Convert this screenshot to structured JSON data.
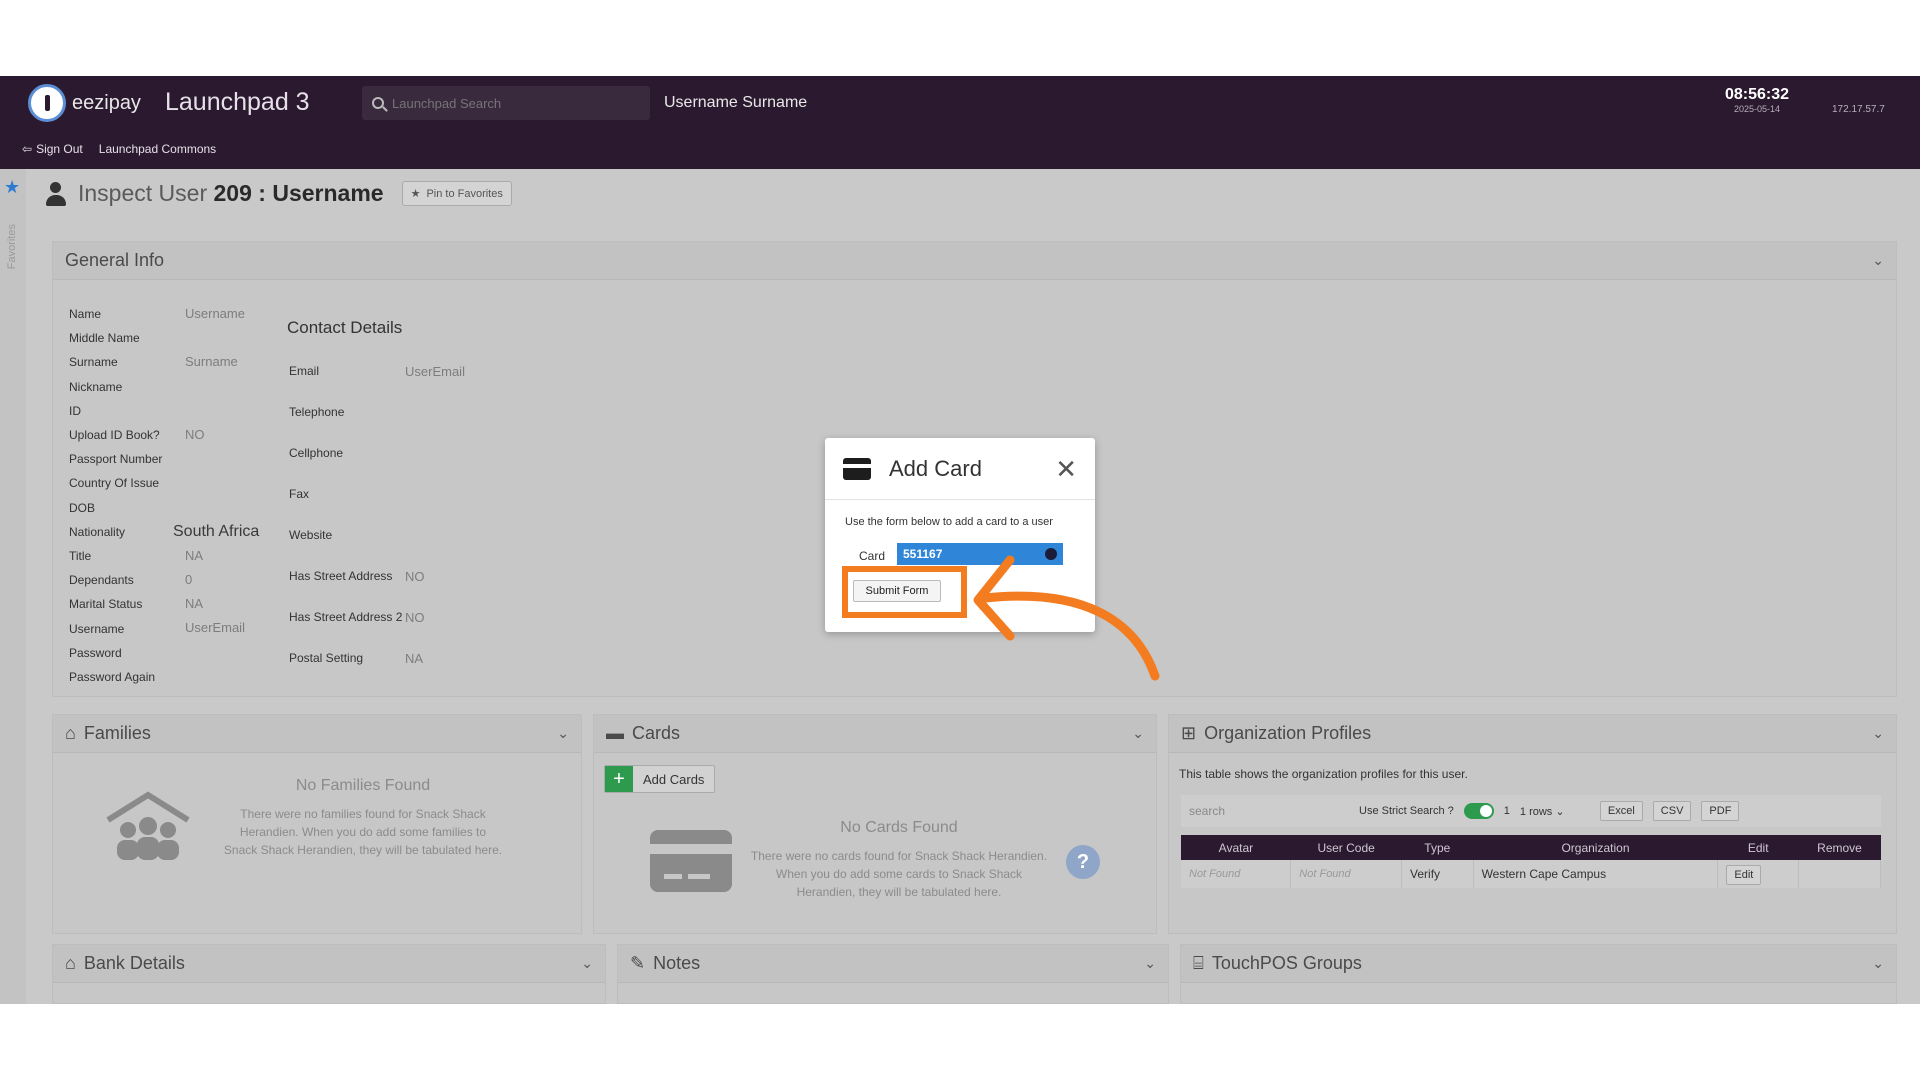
{
  "header": {
    "logo_text": "eezipay",
    "app_title": "Launchpad 3",
    "search_placeholder": "Launchpad Search",
    "user_name": "Username Surname",
    "time": "08:56:32",
    "date": "2025-05-14",
    "ip": "172.17.57.7",
    "sign_out": "Sign Out",
    "commons_link": "Launchpad Commons"
  },
  "rail": {
    "favorites_label": "Favorites"
  },
  "page": {
    "title_prefix": "Inspect User",
    "user_id": "209",
    "separator": ":",
    "username": "Username",
    "pin_label": "Pin to Favorites"
  },
  "general_info": {
    "title": "General Info",
    "fields": [
      {
        "label": "Name",
        "value": "Username"
      },
      {
        "label": "Middle Name",
        "value": ""
      },
      {
        "label": "Surname",
        "value": "Surname"
      },
      {
        "label": "Nickname",
        "value": ""
      },
      {
        "label": "ID",
        "value": ""
      },
      {
        "label": "Upload ID Book?",
        "value": "NO"
      },
      {
        "label": "Passport Number",
        "value": ""
      },
      {
        "label": "Country Of Issue",
        "value": ""
      },
      {
        "label": "DOB",
        "value": ""
      },
      {
        "label": "Nationality",
        "value": "South Africa"
      },
      {
        "label": "Title",
        "value": "NA"
      },
      {
        "label": "Dependants",
        "value": "0"
      },
      {
        "label": "Marital Status",
        "value": "NA"
      },
      {
        "label": "Username",
        "value": "UserEmail"
      },
      {
        "label": "Password",
        "value": ""
      },
      {
        "label": "Password Again",
        "value": ""
      }
    ],
    "contact_title": "Contact Details",
    "contact": [
      {
        "label": "Email",
        "value": "UserEmail"
      },
      {
        "label": "Telephone",
        "value": ""
      },
      {
        "label": "Cellphone",
        "value": ""
      },
      {
        "label": "Fax",
        "value": ""
      },
      {
        "label": "Website",
        "value": ""
      },
      {
        "label": "Has Street Address",
        "value": "NO"
      },
      {
        "label": "Has Street Address 2",
        "value": "NO"
      },
      {
        "label": "Postal Setting",
        "value": "NA"
      }
    ]
  },
  "families": {
    "title": "Families",
    "empty_title": "No Families Found",
    "empty_desc": "There were no families found for Snack Shack Herandien. When you do add some families to Snack Shack Herandien, they will be tabulated here."
  },
  "cards": {
    "title": "Cards",
    "add_button": "Add Cards",
    "empty_title": "No Cards Found",
    "empty_desc": "There were no cards found for Snack Shack Herandien. When you do add some cards to Snack Shack Herandien, they will be tabulated here.",
    "help": "?"
  },
  "org_profiles": {
    "title": "Organization Profiles",
    "description": "This table shows the organization profiles for this user.",
    "search_placeholder": "search",
    "strict_label": "Use Strict Search ?",
    "page": "1",
    "rows_select": "1 rows",
    "export": [
      "Excel",
      "CSV",
      "PDF"
    ],
    "columns": [
      "Avatar",
      "User Code",
      "Type",
      "Organization",
      "Edit",
      "Remove"
    ],
    "rows": [
      {
        "avatar": "Not Found",
        "user_code": "Not Found",
        "type": "Verify",
        "organization": "Western Cape Campus",
        "edit": "Edit",
        "remove": ""
      }
    ]
  },
  "bottom_panels": {
    "bank": "Bank Details",
    "notes": "Notes",
    "touchpos": "TouchPOS Groups"
  },
  "modal": {
    "title": "Add Card",
    "description": "Use the form below to add a card to a user",
    "card_label": "Card",
    "card_value": "551167",
    "submit": "Submit Form"
  },
  "colors": {
    "header_bg": "#2b1a2f",
    "accent_blue": "#2f86d9",
    "highlight_orange": "#f47c20",
    "add_green": "#2e9a4e"
  }
}
